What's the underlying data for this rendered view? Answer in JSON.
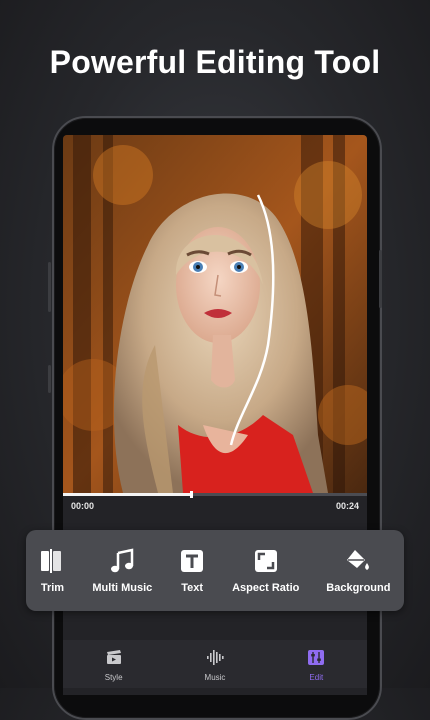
{
  "headline": "Powerful Editing Tool",
  "player": {
    "current_time": "00:00",
    "duration": "00:24",
    "progress_fraction": 0.42
  },
  "tools": [
    {
      "label": "Trim",
      "icon": "trim-icon"
    },
    {
      "label": "Multi Music",
      "icon": "music-note-icon"
    },
    {
      "label": "Text",
      "icon": "text-icon"
    },
    {
      "label": "Aspect Ratio",
      "icon": "aspect-ratio-icon"
    },
    {
      "label": "Background",
      "icon": "paint-bucket-icon"
    }
  ],
  "nav": [
    {
      "label": "Style",
      "icon": "clapperboard-icon",
      "active": false
    },
    {
      "label": "Music",
      "icon": "waveform-icon",
      "active": false
    },
    {
      "label": "Edit",
      "icon": "sliders-icon",
      "active": true
    }
  ],
  "colors": {
    "accent": "#8f6cf0",
    "toolbar_bg": "#4a4b50",
    "nav_bg": "#2a2a2f"
  }
}
